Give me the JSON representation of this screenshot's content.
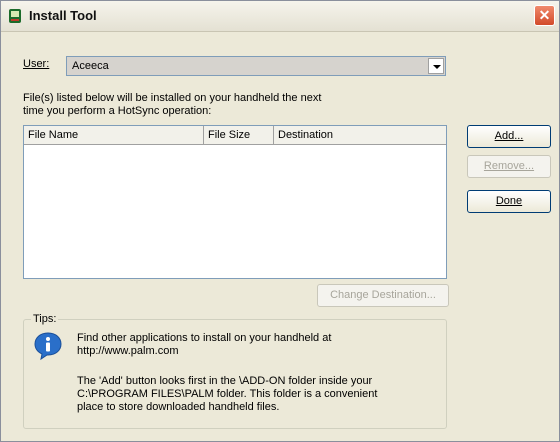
{
  "window": {
    "title": "Install Tool",
    "close_glyph": "✕"
  },
  "user": {
    "label": "User:",
    "selected": "Aceeca"
  },
  "description": {
    "line1": "File(s) listed below will be installed on your handheld the next",
    "line2": "time you perform a HotSync operation:"
  },
  "list": {
    "columns": [
      "File Name",
      "File Size",
      "Destination"
    ],
    "rows": []
  },
  "buttons": {
    "add": "Add...",
    "remove": "Remove...",
    "done": "Done",
    "change_destination": "Change Destination..."
  },
  "tips": {
    "label": "Tips:",
    "line1": "Find other applications to install on your handheld at",
    "line2": "http://www.palm.com",
    "line3": "The 'Add' button looks first in the \\ADD-ON folder inside your",
    "line4": "C:\\PROGRAM FILES\\PALM folder. This folder is a convenient",
    "line5": "place to store downloaded handheld files."
  },
  "icons": {
    "app": "palm-app-icon",
    "close": "close-icon",
    "dropdown": "chevron-down-icon",
    "info": "info-icon"
  },
  "colors": {
    "window_bg": "#ece9d8",
    "close_button": "#d24a2a",
    "info_icon": "#2a6fc9",
    "disabled_text": "#a7a59b"
  }
}
